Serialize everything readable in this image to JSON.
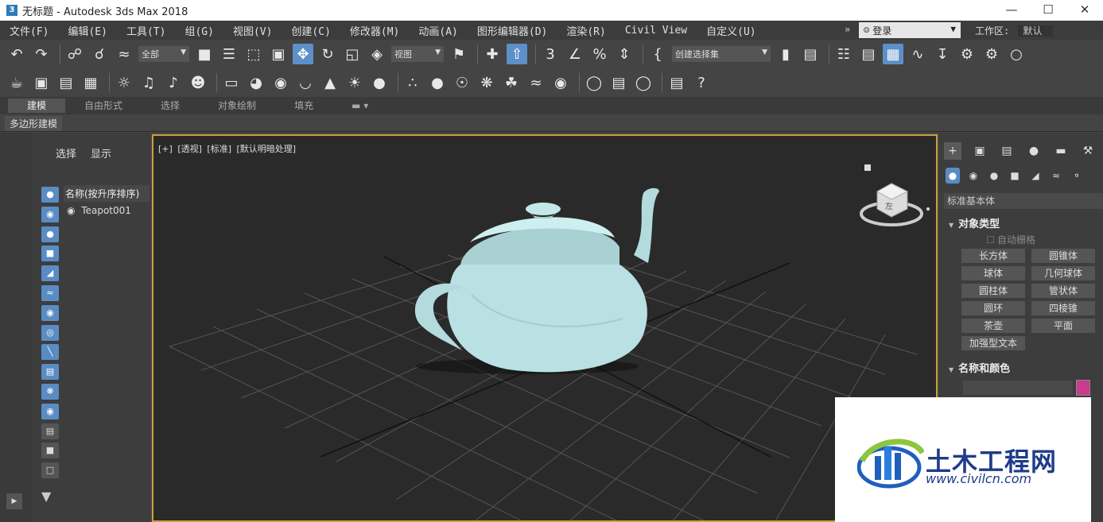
{
  "window": {
    "app_icon": "3",
    "title": "无标题 - Autodesk 3ds Max 2018",
    "minimize": "—",
    "maximize": "☐",
    "close": "✕"
  },
  "menubar": {
    "items": [
      "文件(F)",
      "编辑(E)",
      "工具(T)",
      "组(G)",
      "视图(V)",
      "创建(C)",
      "修改器(M)",
      "动画(A)",
      "图形编辑器(D)",
      "渲染(R)",
      "Civil View",
      "自定义(U)"
    ],
    "more": "»",
    "login": "登录",
    "workspace_label": "工作区:",
    "workspace_value": "默认"
  },
  "toolbar1": {
    "selection_filter": "全部",
    "ref_coord": "视图",
    "selection_set": "创建选择集"
  },
  "ribbon": {
    "tabs": [
      "建模",
      "自由形式",
      "选择",
      "对象绘制",
      "填充"
    ],
    "sub_label": "多边形建模"
  },
  "scene_explorer": {
    "tab_select": "选择",
    "tab_display": "显示",
    "column_header": "名称(按升序排序)",
    "objects": [
      "Teapot001"
    ]
  },
  "viewport": {
    "labels": [
      "[+]",
      "[透视]",
      "[标准]",
      "[默认明暗处理]"
    ],
    "viewcube_label": "左"
  },
  "command_panel": {
    "category": "标准基本体",
    "rollout_object_type": "对象类型",
    "autogrid": "自动栅格",
    "object_buttons": [
      "长方体",
      "圆锥体",
      "球体",
      "几何球体",
      "圆柱体",
      "管状体",
      "圆环",
      "四棱锥",
      "茶壶",
      "平面",
      "加强型文本"
    ],
    "rollout_name_color": "名称和颜色",
    "object_color": "#cc3a8e"
  },
  "watermark": {
    "title": "土木工程网",
    "url": "www.civilcn.com"
  },
  "colors": {
    "accent": "#5a8cc4",
    "viewport_border": "#c9a23b",
    "teapot": "#b9e0e2"
  }
}
